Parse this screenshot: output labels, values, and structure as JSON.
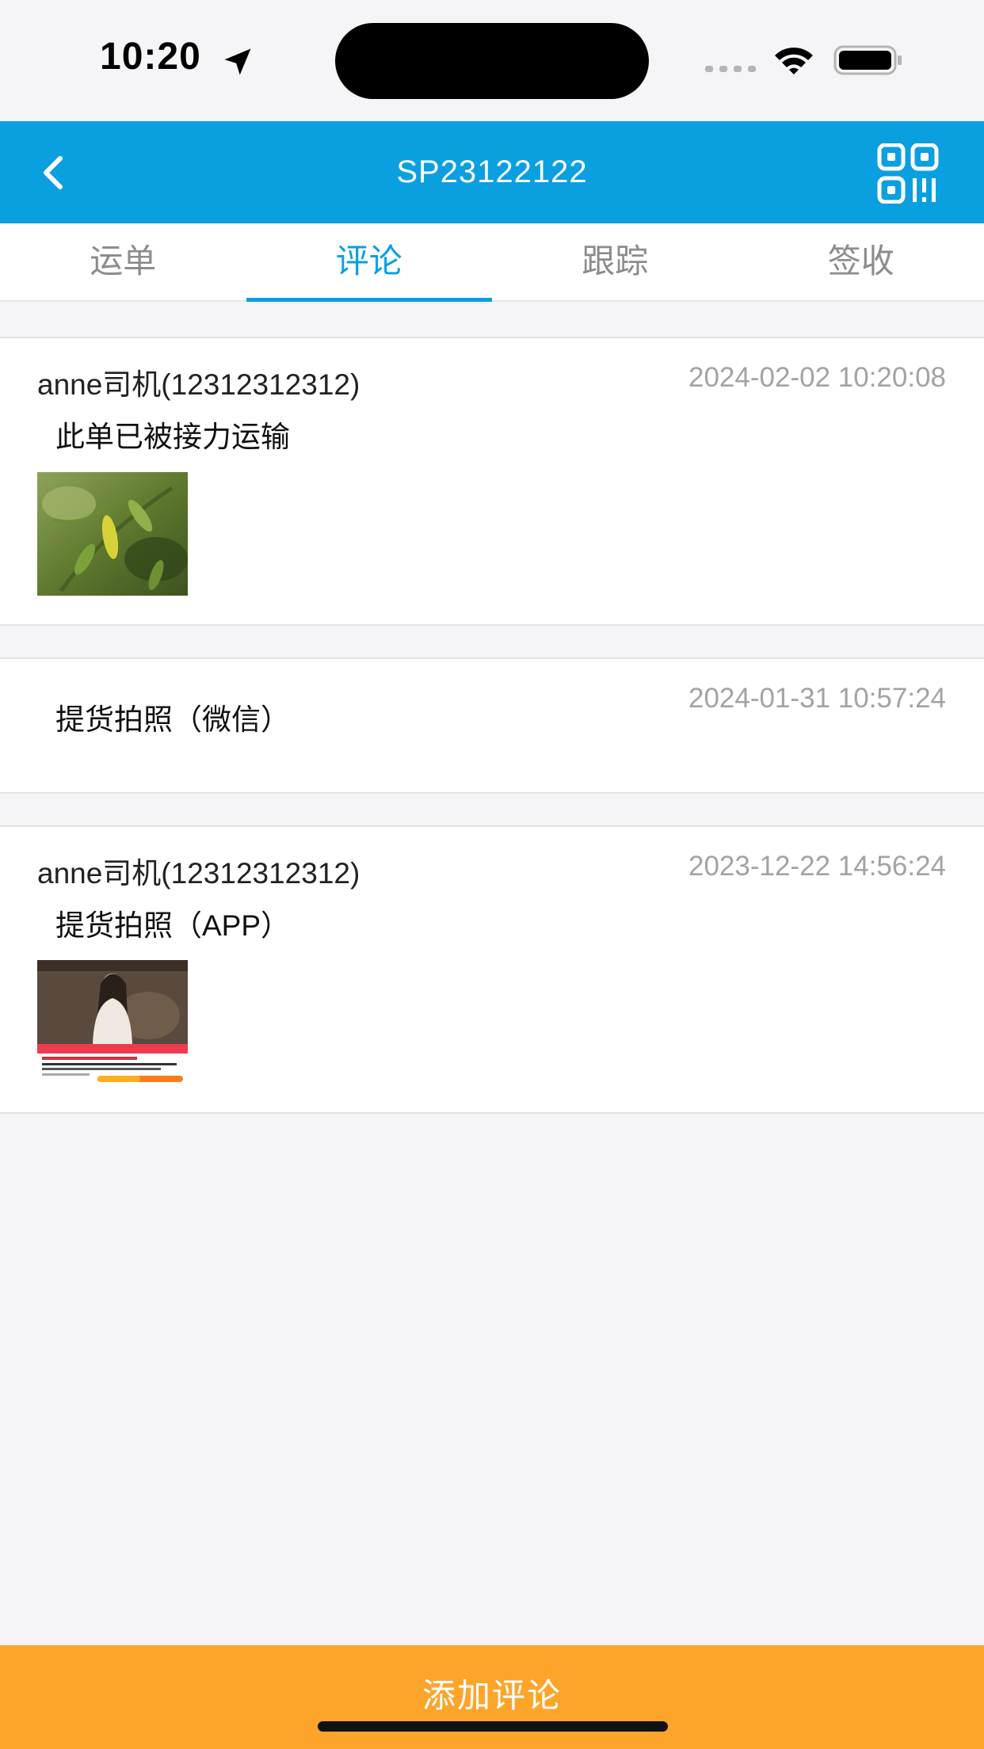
{
  "status_bar": {
    "time": "10:20"
  },
  "header": {
    "title": "SP23122122",
    "back_icon": "chevron-left-icon",
    "qr_icon": "qr-code-icon"
  },
  "tabs": [
    {
      "label": "运单",
      "active": false
    },
    {
      "label": "评论",
      "active": true
    },
    {
      "label": "跟踪",
      "active": false
    },
    {
      "label": "签收",
      "active": false
    }
  ],
  "comments": [
    {
      "author": "anne司机(12312312312)",
      "time": "2024-02-02 10:20:08",
      "text": "此单已被接力运输",
      "image": "leaf-photo"
    },
    {
      "author": "",
      "time": "2024-01-31 10:57:24",
      "text": "提货拍照（微信）",
      "image": ""
    },
    {
      "author": "anne司机(12312312312)",
      "time": "2023-12-22 14:56:24",
      "text": "提货拍照（APP）",
      "image": "app-screenshot-photo"
    }
  ],
  "footer": {
    "add_comment_label": "添加评论"
  },
  "colors": {
    "primary": "#0aa0e0",
    "accent": "#fda52a",
    "time_text": "#a3a3a3"
  }
}
